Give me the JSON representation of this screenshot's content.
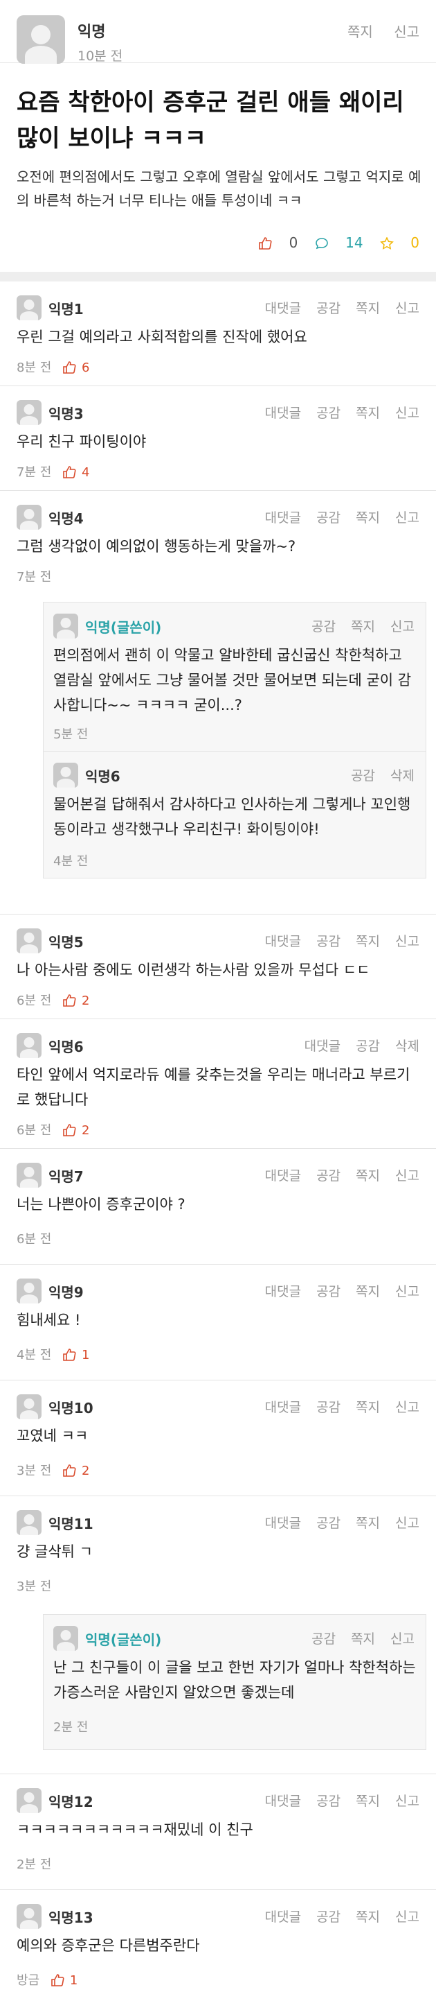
{
  "post": {
    "author": "익명",
    "time": "10분 전",
    "actions": [
      "쪽지",
      "신고"
    ],
    "title": "요즘 착한아이 증후군 걸린 애들 왜이리 많이 보이냐 ㅋㅋㅋ",
    "body": "오전에 편의점에서도 그렇고 오후에 열람실 앞에서도 그렇고 억지로 예의 바른척 하는거 너무 티나는 애들 투성이네 ㅋㅋ",
    "likes": "0",
    "comments": "14",
    "scraps": "0"
  },
  "comments": [
    {
      "name": "익명1",
      "actions": [
        "대댓글",
        "공감",
        "쪽지",
        "신고"
      ],
      "text": "우린 그걸 예의라고 사회적합의를 진작에 했어요",
      "time": "8분 전",
      "likes": "6"
    },
    {
      "name": "익명3",
      "actions": [
        "대댓글",
        "공감",
        "쪽지",
        "신고"
      ],
      "text": "우리 친구 파이팅이야",
      "time": "7분 전",
      "likes": "4"
    },
    {
      "name": "익명4",
      "actions": [
        "대댓글",
        "공감",
        "쪽지",
        "신고"
      ],
      "text": "그럼 생각없이 예의없이 행동하는게 맞을까~?",
      "time": "7분 전",
      "likes": ""
    },
    {
      "name": "익명5",
      "actions": [
        "대댓글",
        "공감",
        "쪽지",
        "신고"
      ],
      "text": "나 아는사람 중에도 이런생각 하는사람 있을까 무섭다 ㄷㄷ",
      "time": "6분 전",
      "likes": "2"
    },
    {
      "name": "익명6",
      "actions": [
        "대댓글",
        "공감",
        "삭제"
      ],
      "text": "타인 앞에서 억지로라듀 예를 갖추는것을 우리는 매너라고 부르기로 했답니다",
      "time": "6분 전",
      "likes": "2"
    },
    {
      "name": "익명7",
      "actions": [
        "대댓글",
        "공감",
        "쪽지",
        "신고"
      ],
      "text": "너는 나쁜아이 증후군이야 ?",
      "time": "6분 전",
      "likes": ""
    },
    {
      "name": "익명9",
      "actions": [
        "대댓글",
        "공감",
        "쪽지",
        "신고"
      ],
      "text": "힘내세요 !",
      "time": "4분 전",
      "likes": "1"
    },
    {
      "name": "익명10",
      "actions": [
        "대댓글",
        "공감",
        "쪽지",
        "신고"
      ],
      "text": "꼬였네 ㅋㅋ",
      "time": "3분 전",
      "likes": "2"
    },
    {
      "name": "익명11",
      "actions": [
        "대댓글",
        "공감",
        "쪽지",
        "신고"
      ],
      "text": "걍 글삭튀 ㄱ",
      "time": "3분 전",
      "likes": ""
    },
    {
      "name": "익명12",
      "actions": [
        "대댓글",
        "공감",
        "쪽지",
        "신고"
      ],
      "text": "ㅋㅋㅋㅋㅋㅋㅋㅋㅋㅋㅋ재밌네 이 친구",
      "time": "2분 전",
      "likes": ""
    },
    {
      "name": "익명13",
      "actions": [
        "대댓글",
        "공감",
        "쪽지",
        "신고"
      ],
      "text": "예의와 증후군은 다른범주란다",
      "time": "방금",
      "likes": "1"
    }
  ],
  "replies": [
    {
      "name": "익명(글쓴이)",
      "actions": [
        "공감",
        "쪽지",
        "신고"
      ],
      "text": "편의점에서 괜히 이 악물고 알바한테 굽신굽신 착한척하고 열람실 앞에서도 그냥 물어볼 것만 물어보면 되는데 굳이 감사합니다~~ ㅋㅋㅋㅋ 굳이...?",
      "time": "5분 전"
    },
    {
      "name": "익명6",
      "actions": [
        "공감",
        "삭제"
      ],
      "text": "물어본걸 답해줘서 감사하다고 인사하는게 그렇게나 꼬인행동이라고 생각했구나 우리친구! 화이팅이야!",
      "time": "4분 전"
    },
    {
      "name": "익명(글쓴이)",
      "actions": [
        "공감",
        "쪽지",
        "신고"
      ],
      "text": "난 그 친구들이 이 글을 보고 한번 자기가 얼마나 착한척하는 가증스러운 사람인지 알았으면 좋겠는데",
      "time": "2분 전"
    }
  ],
  "colors": {
    "accent": "#d94a2b",
    "op": "#2aa3a8",
    "comment_icon": "#2aa3a8",
    "scrap_icon": "#f2b705"
  }
}
